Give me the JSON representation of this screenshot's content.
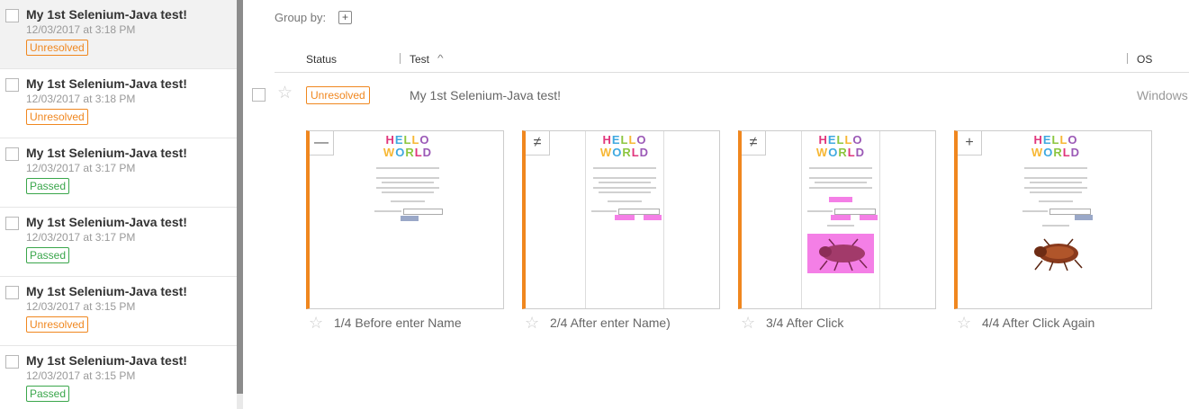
{
  "sidebar": {
    "runs": [
      {
        "title": "My 1st Selenium-Java test!",
        "date": "12/03/2017 at 3:18 PM",
        "status": "Unresolved"
      },
      {
        "title": "My 1st Selenium-Java test!",
        "date": "12/03/2017 at 3:18 PM",
        "status": "Unresolved"
      },
      {
        "title": "My 1st Selenium-Java test!",
        "date": "12/03/2017 at 3:17 PM",
        "status": "Passed"
      },
      {
        "title": "My 1st Selenium-Java test!",
        "date": "12/03/2017 at 3:17 PM",
        "status": "Passed"
      },
      {
        "title": "My 1st Selenium-Java test!",
        "date": "12/03/2017 at 3:15 PM",
        "status": "Unresolved"
      },
      {
        "title": "My 1st Selenium-Java test!",
        "date": "12/03/2017 at 3:15 PM",
        "status": "Passed"
      }
    ]
  },
  "toolbar": {
    "group_by_label": "Group by:",
    "add_icon": "+"
  },
  "columns": {
    "status": "Status",
    "test": "Test",
    "test_sort_icon": "^",
    "os": "OS"
  },
  "row": {
    "status": "Unresolved",
    "name": "My 1st Selenium-Java test!",
    "os": "Windows",
    "star_icon": "☆"
  },
  "steps": [
    {
      "label": "1/4 Before enter Name",
      "diff_icon": "—"
    },
    {
      "label": "2/4 After enter Name)",
      "diff_icon": "≠"
    },
    {
      "label": "3/4 After Click",
      "diff_icon": "≠"
    },
    {
      "label": "4/4 After Click Again",
      "diff_icon": "+"
    }
  ],
  "thumb_text": {
    "hello": [
      "H",
      "E",
      "L",
      "L",
      "O"
    ],
    "world": [
      "W",
      "O",
      "R",
      "L",
      "D"
    ]
  },
  "colors": {
    "unresolved": "#f0871f",
    "passed": "#3aa64b",
    "accent_border": "#f0871f",
    "bug_highlight": "#f47fe6"
  }
}
